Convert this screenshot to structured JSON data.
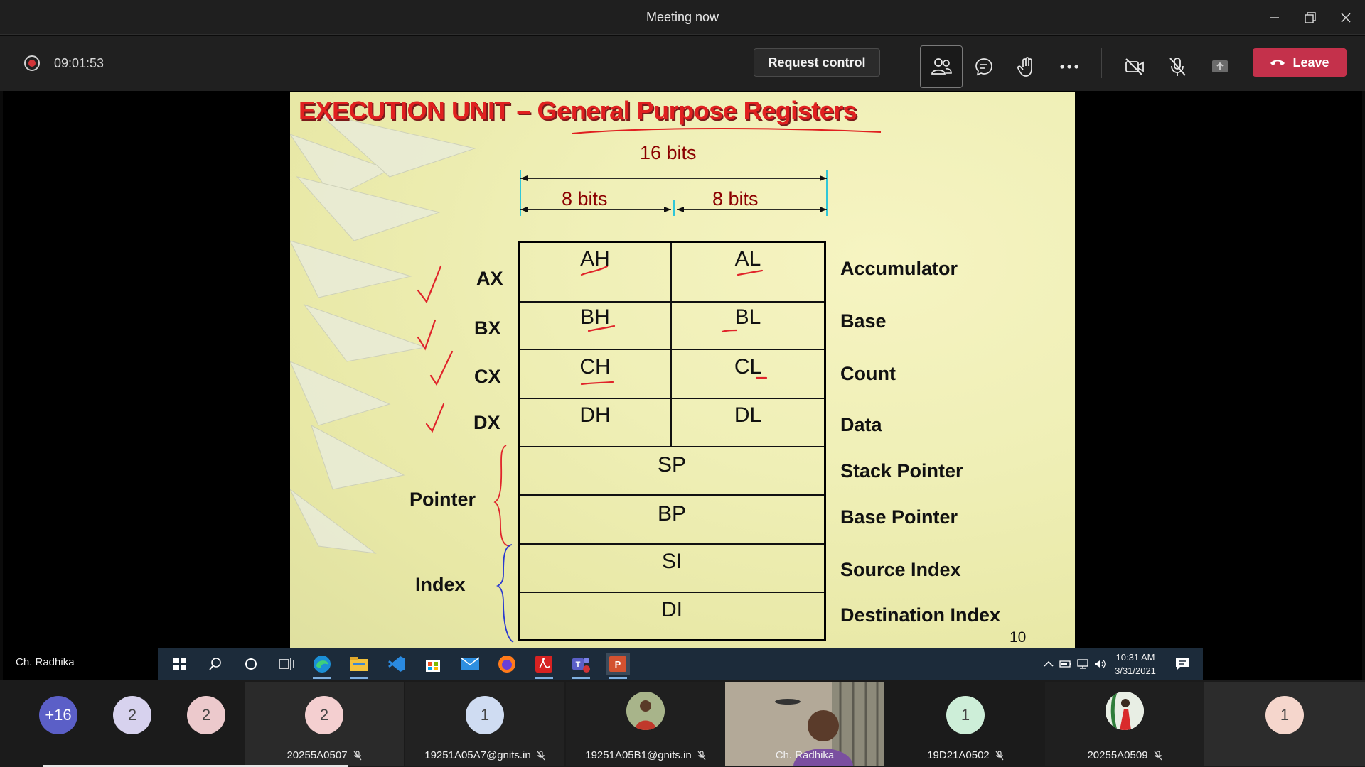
{
  "window": {
    "title": "Meeting now"
  },
  "toolbar": {
    "timer": "09:01:53",
    "request_control": "Request control",
    "leave": "Leave",
    "icons": [
      "participants-icon",
      "chat-icon",
      "raise-hand-icon",
      "more-icon",
      "camera-off-icon",
      "mic-off-icon",
      "share-tray-icon"
    ]
  },
  "slide": {
    "title": "EXECUTION UNIT – General Purpose Registers",
    "dim16": "16 bits",
    "dim8a": "8 bits",
    "dim8b": "8 bits",
    "cells": {
      "ah": "AH",
      "al": "AL",
      "bh": "BH",
      "bl": "BL",
      "ch": "CH",
      "cl": "CL",
      "dh": "DH",
      "dl": "DL",
      "sp": "SP",
      "bp": "BP",
      "si": "SI",
      "di": "DI"
    },
    "left_labels": {
      "ax": "AX",
      "bx": "BX",
      "cx": "CX",
      "dx": "DX",
      "pointer": "Pointer",
      "index": "Index"
    },
    "right_labels": {
      "accumulator": "Accumulator",
      "base": "Base",
      "count": "Count",
      "data": "Data",
      "stack_pointer": "Stack Pointer",
      "base_pointer": "Base Pointer",
      "source_index": "Source Index",
      "destination_index": "Destination Index"
    },
    "page": "10",
    "accent_color": "#e02020"
  },
  "presenter": {
    "name": "Ch. Radhika"
  },
  "taskbar": {
    "time": "10:31 AM",
    "date": "3/31/2021"
  },
  "participants": [
    {
      "label": "+16",
      "color": "#5b5fc7",
      "text_color": "#ffffff"
    },
    {
      "label": "2",
      "color": "#d7d2ee",
      "text_color": "#444"
    },
    {
      "label": "2",
      "color": "#ecc9cc",
      "text_color": "#444"
    },
    {
      "label": "2",
      "color": "#f4cfd0",
      "text_color": "#444",
      "name": "20255A0507"
    },
    {
      "label": "1",
      "color": "#cfdcf2",
      "text_color": "#444",
      "name": "19251A05A7@gnits.in"
    },
    {
      "name": "19251A05B1@gnits.in"
    },
    {
      "name": "Ch. Radhika"
    },
    {
      "label": "1",
      "color": "#cdeed8",
      "text_color": "#444",
      "name": "19D21A0502"
    },
    {
      "name": "20255A0509"
    },
    {
      "label": "1",
      "color": "#f5d6cc",
      "text_color": "#444"
    }
  ]
}
